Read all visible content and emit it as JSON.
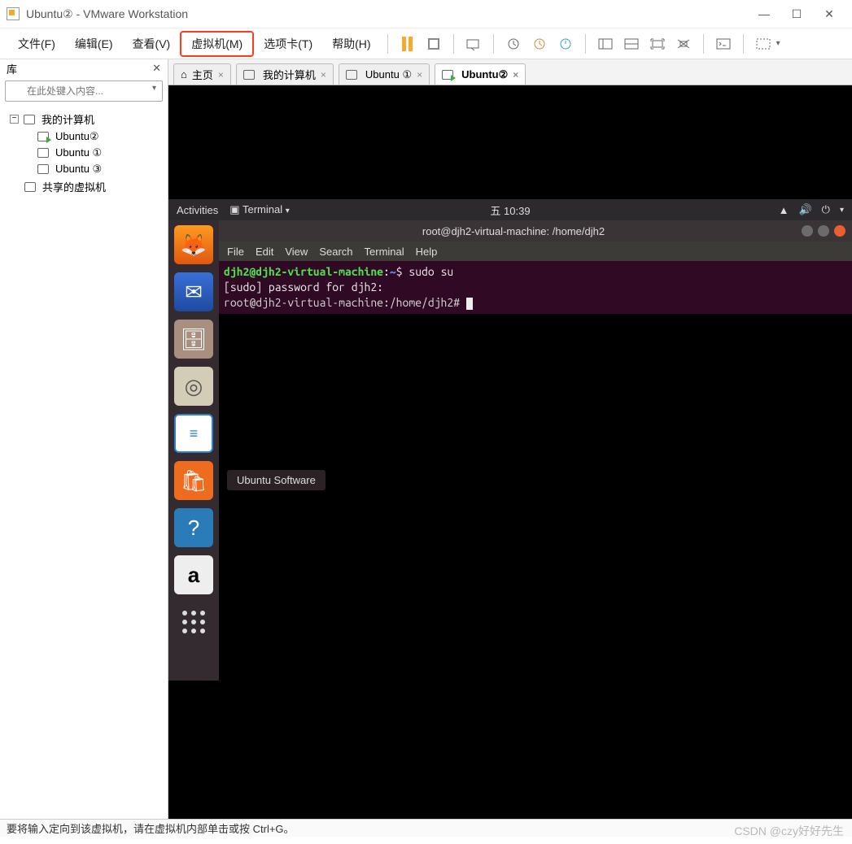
{
  "window": {
    "title": "Ubuntu② - VMware Workstation"
  },
  "menubar": {
    "file": "文件(F)",
    "edit": "编辑(E)",
    "view": "查看(V)",
    "vm": "虚拟机(M)",
    "tabs": "选项卡(T)",
    "help": "帮助(H)"
  },
  "sidebar": {
    "title": "库",
    "search_placeholder": "在此处键入内容...",
    "dropdown_glyph": "▾",
    "root": "我的计算机",
    "vms": [
      {
        "label": "Ubuntu②",
        "running": true
      },
      {
        "label": "Ubuntu ①",
        "running": false
      },
      {
        "label": "Ubuntu ③",
        "running": false
      }
    ],
    "shared": "共享的虚拟机"
  },
  "tabs": [
    {
      "label": "主页",
      "icon": "home",
      "closable": true
    },
    {
      "label": "我的计算机",
      "icon": "monitor",
      "closable": true
    },
    {
      "label": "Ubuntu ①",
      "icon": "vm",
      "closable": true
    },
    {
      "label": "Ubuntu②",
      "icon": "vm-run",
      "closable": true,
      "active": true
    }
  ],
  "ubuntu": {
    "activities": "Activities",
    "app_indicator": "Terminal",
    "clock": "五 10:39",
    "tooltip": "Ubuntu Software"
  },
  "terminal": {
    "title": "root@djh2-virtual-machine: /home/djh2",
    "menus": [
      "File",
      "Edit",
      "View",
      "Search",
      "Terminal",
      "Help"
    ],
    "line1_userhost": "djh2@djh2-virtual-machine",
    "line1_sep": ":",
    "line1_path": "~",
    "line1_prompt": "$ ",
    "line1_cmd": "sudo su",
    "line2": "[sudo] password for djh2:",
    "line3_prompt": "root@djh2-virtual-machine:/home/djh2# "
  },
  "statusbar": {
    "text": "要将输入定向到该虚拟机，请在虚拟机内部单击或按 Ctrl+G。"
  },
  "watermark": "CSDN @czy好好先生"
}
